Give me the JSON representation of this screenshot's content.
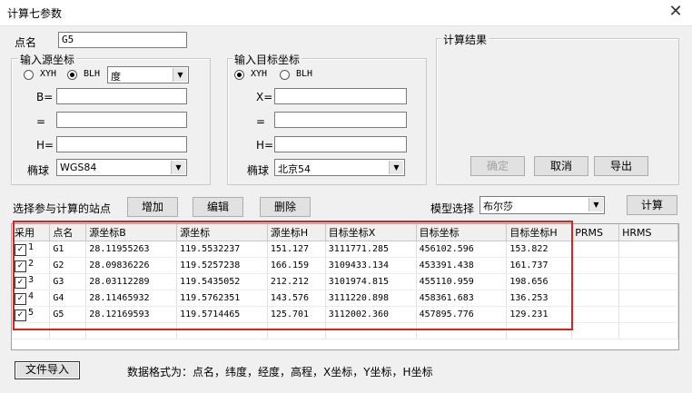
{
  "window": {
    "title": "计算七参数",
    "close_glyph": "✕"
  },
  "point_name": {
    "label": "点名",
    "value": "G5"
  },
  "source": {
    "group_title": "输入源坐标",
    "radio_xyh": "XYH",
    "radio_blh": "BLH",
    "selected": "BLH",
    "unit_select": "度",
    "b_label": "B=",
    "l_label": "=",
    "h_label": "H=",
    "b_value": "",
    "l_value": "",
    "h_value": "",
    "ellipsoid_label": "椭球",
    "ellipsoid_value": "WGS84"
  },
  "target": {
    "group_title": "输入目标坐标",
    "radio_xyh": "XYH",
    "radio_blh": "BLH",
    "selected": "XYH",
    "x_label": "X=",
    "y_label": "=",
    "h_label": "H=",
    "x_value": "",
    "y_value": "",
    "h_value": "",
    "ellipsoid_label": "椭球",
    "ellipsoid_value": "北京54"
  },
  "result": {
    "group_title": "计算结果",
    "ok_label": "确定",
    "cancel_label": "取消",
    "export_label": "导出"
  },
  "stations": {
    "label": "选择参与计算的站点",
    "add_label": "增加",
    "edit_label": "编辑",
    "delete_label": "删除",
    "model_label": "模型选择",
    "model_value": "布尔莎",
    "compute_label": "计算"
  },
  "table": {
    "headers": [
      "采用",
      "点名",
      "源坐标B",
      "源坐标",
      "源坐标H",
      "目标坐标X",
      "目标坐标",
      "目标坐标H",
      "PRMS",
      "HRMS"
    ],
    "rows": [
      {
        "use": "1",
        "name": "G1",
        "b": "28.11955263",
        "l": "119.5532237",
        "h": "151.127",
        "x": "3111771.285",
        "y": "456102.596",
        "th": "153.822"
      },
      {
        "use": "2",
        "name": "G2",
        "b": "28.09836226",
        "l": "119.5257238",
        "h": "166.159",
        "x": "3109433.134",
        "y": "453391.438",
        "th": "161.737"
      },
      {
        "use": "3",
        "name": "G3",
        "b": "28.03112289",
        "l": "119.5435052",
        "h": "212.212",
        "x": "3101974.815",
        "y": "455110.959",
        "th": "198.656"
      },
      {
        "use": "4",
        "name": "G4",
        "b": "28.11465932",
        "l": "119.5762351",
        "h": "143.576",
        "x": "3111220.898",
        "y": "458361.683",
        "th": "136.253"
      },
      {
        "use": "5",
        "name": "G5",
        "b": "28.12169593",
        "l": "119.5714465",
        "h": "125.701",
        "x": "3112002.360",
        "y": "457895.776",
        "th": "129.231"
      }
    ]
  },
  "footer": {
    "import_label": "文件导入",
    "format_note": "数据格式为：点名，纬度，经度，高程，X坐标，Y坐标，H坐标"
  },
  "colors": {
    "highlight": "#e02020",
    "window_bg": "#f0f0f0"
  }
}
